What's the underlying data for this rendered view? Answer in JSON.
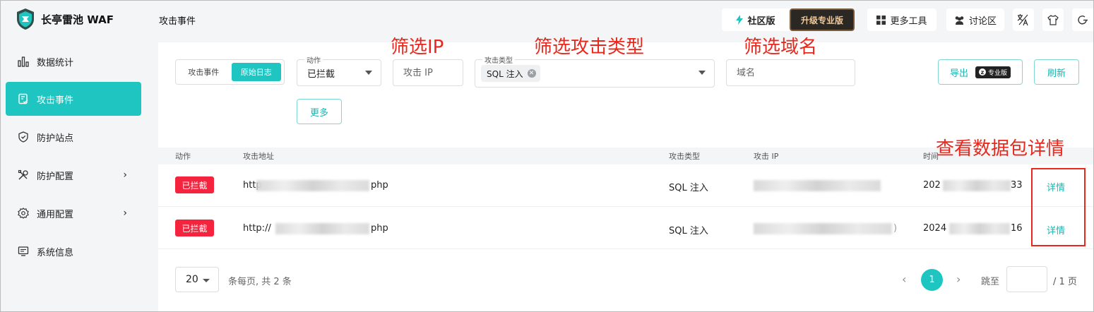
{
  "app": {
    "name": "长亭雷池 WAF"
  },
  "sidebar": {
    "items": [
      {
        "label": "数据统计",
        "icon": "bar-chart-icon",
        "active": false,
        "has_submenu": false
      },
      {
        "label": "攻击事件",
        "icon": "document-check-icon",
        "active": true,
        "has_submenu": false
      },
      {
        "label": "防护站点",
        "icon": "shield-icon",
        "active": false,
        "has_submenu": false
      },
      {
        "label": "防护配置",
        "icon": "tools-icon",
        "active": false,
        "has_submenu": true
      },
      {
        "label": "通用配置",
        "icon": "gear-icon",
        "active": false,
        "has_submenu": true
      },
      {
        "label": "系统信息",
        "icon": "monitor-icon",
        "active": false,
        "has_submenu": false
      }
    ],
    "submenu_chevron": "›"
  },
  "header": {
    "page_title": "攻击事件",
    "community_label": "社区版",
    "upgrade_label": "升级专业版",
    "more_tools_label": "更多工具",
    "forum_label": "讨论区",
    "lang_icon": "translate-icon",
    "theme_icon": "shirt-icon",
    "logout_icon": "power-icon"
  },
  "filters": {
    "segment": {
      "option1": "攻击事件",
      "option2": "原始日志",
      "selected": "原始日志"
    },
    "action": {
      "label": "动作",
      "value": "已拦截"
    },
    "attack_ip": {
      "placeholder": "攻击 IP"
    },
    "attack_type": {
      "label": "攻击类型",
      "chip": "SQL 注入"
    },
    "domain": {
      "placeholder": "域名"
    },
    "more_label": "更多",
    "export_label": "导出",
    "export_badge": "专业版",
    "refresh_label": "刷新"
  },
  "annotations": {
    "filter_ip": "筛选IP",
    "filter_type": "筛选攻击类型",
    "filter_domain": "筛选域名",
    "view_packet": "查看数据包详情",
    "highlight_color": "#e8281d"
  },
  "table": {
    "columns": {
      "action": "动作",
      "url": "攻击地址",
      "type": "攻击类型",
      "ip": "攻击 IP",
      "time": "时间"
    },
    "rows": [
      {
        "action": "已拦截",
        "url_prefix": "http",
        "url_suffix": "php",
        "type": "SQL 注入",
        "ip_tail": "",
        "time_prefix": "202",
        "time_suffix": "33",
        "detail": "详情"
      },
      {
        "action": "已拦截",
        "url_prefix": "http://",
        "url_suffix": "php",
        "type": "SQL 注入",
        "ip_tail": ")",
        "time_prefix": "2024",
        "time_suffix": "16",
        "detail": "详情"
      }
    ]
  },
  "pagination": {
    "page_size": "20",
    "summary": "条每页, 共 2 条",
    "current_page": "1",
    "prev_icon": "‹",
    "next_icon": "›",
    "jump_label": "跳至",
    "total_pages": "/ 1 页"
  },
  "colors": {
    "accent": "#1fc5c1",
    "danger": "#f5243e",
    "annotation": "#e8281d"
  }
}
